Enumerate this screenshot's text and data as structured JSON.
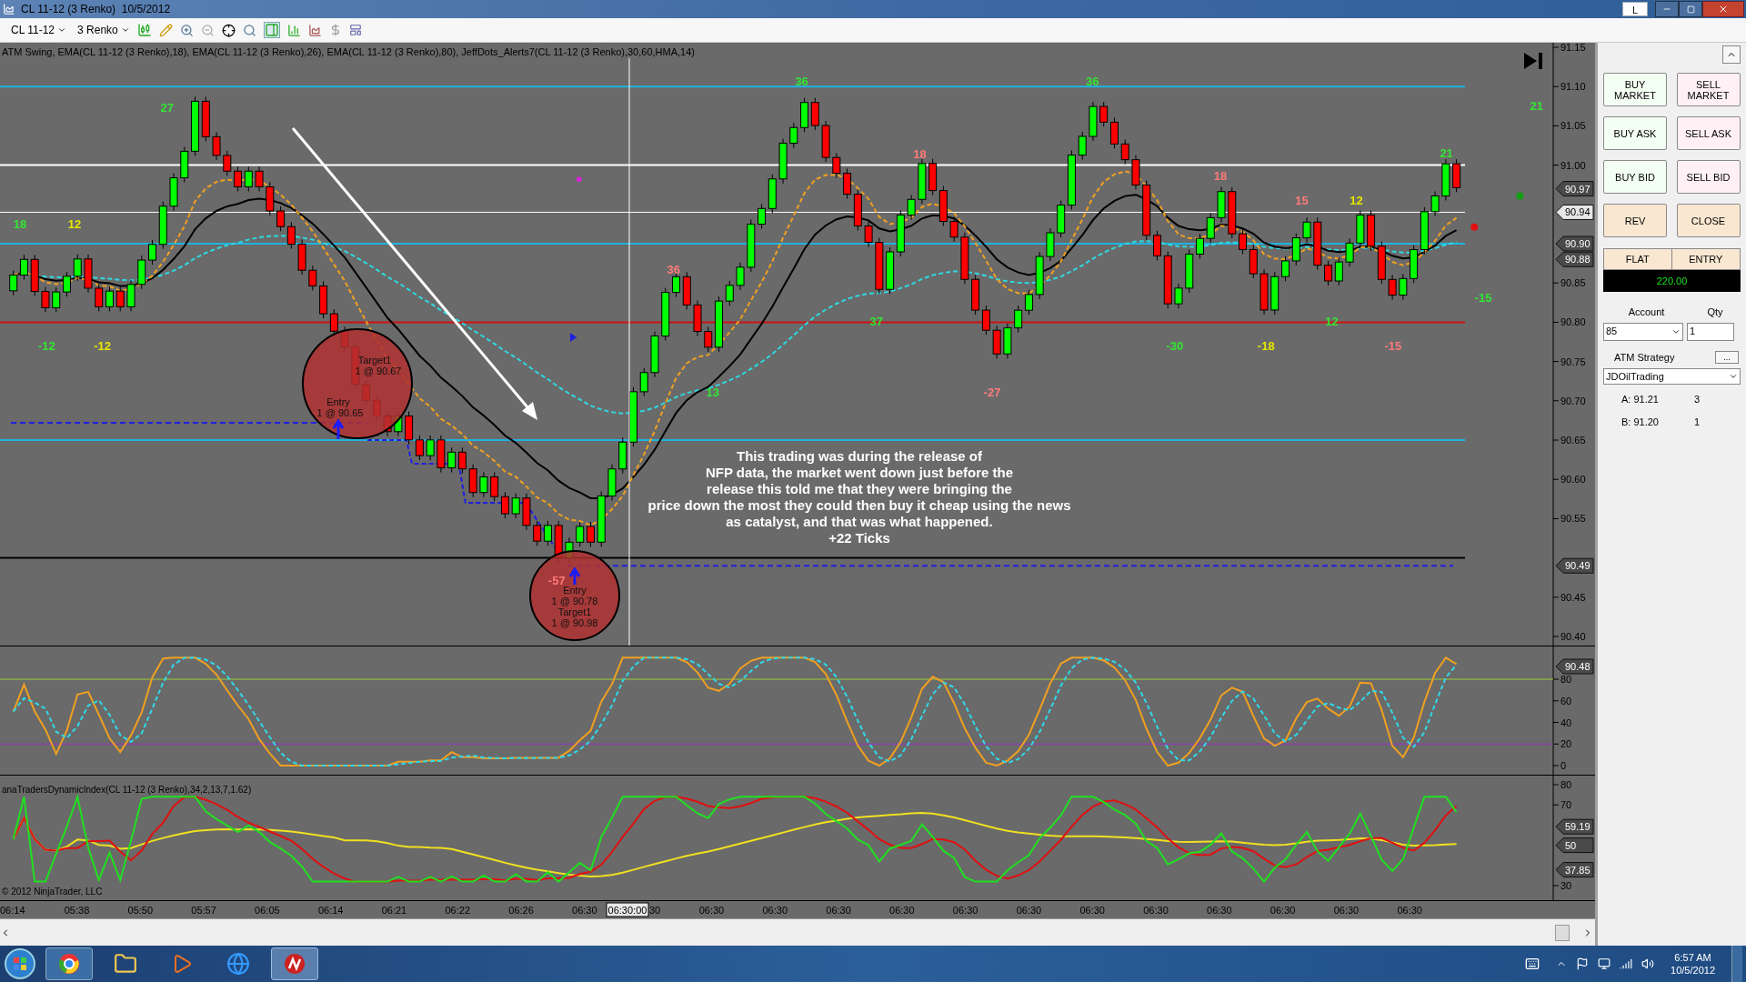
{
  "window": {
    "title": "CL 11-12 (3 Renko)  10/5/2012",
    "link_button": "L"
  },
  "toolbar": {
    "instrument": "CL 11-12",
    "period": "3 Renko"
  },
  "chart": {
    "indicators_label": "ATM Swing, EMA(CL 11-12 (3 Renko),18), EMA(CL 11-12 (3 Renko),26), EMA(CL 11-12 (3 Renko),80), JeffDots_Alerts7(CL 11-12 (3 Renko),30,60,HMA,14)",
    "price_ticks": [
      "91.15",
      "91.10",
      "91.05",
      "91.00",
      "90.85",
      "90.80",
      "90.75",
      "90.70",
      "90.65",
      "90.60",
      "90.55",
      "90.45",
      "90.40"
    ],
    "price_flags": [
      {
        "text": "90.97",
        "kind": "indicator"
      },
      {
        "text": "90.94",
        "kind": "last"
      },
      {
        "text": "90.90",
        "kind": "indicator"
      },
      {
        "text": "90.88",
        "kind": "indicator"
      },
      {
        "text": "90.49",
        "kind": "indicator"
      }
    ],
    "swing_labels": [
      {
        "text": "27",
        "color": "#33e633"
      },
      {
        "text": "18",
        "color": "#33e633"
      },
      {
        "text": "12",
        "color": "#e6e600"
      },
      {
        "text": "-12",
        "color": "#33e633"
      },
      {
        "text": "-12",
        "color": "#e6e600"
      },
      {
        "text": "36",
        "color": "#ff7a7a"
      },
      {
        "text": "13",
        "color": "#33e633"
      },
      {
        "text": "36",
        "color": "#33e633"
      },
      {
        "text": "18",
        "color": "#ff7a7a"
      },
      {
        "text": "37",
        "color": "#33e633"
      },
      {
        "text": "-27",
        "color": "#ff7a7a"
      },
      {
        "text": "36",
        "color": "#33e633"
      },
      {
        "text": "18",
        "color": "#ff7a7a"
      },
      {
        "text": "15",
        "color": "#ff7a7a"
      },
      {
        "text": "12",
        "color": "#e6e600"
      },
      {
        "text": "21",
        "color": "#33e633"
      },
      {
        "text": "21",
        "color": "#33e633"
      },
      {
        "text": "-15",
        "color": "#33e633"
      },
      {
        "text": "-30",
        "color": "#33e633"
      },
      {
        "text": "-18",
        "color": "#e6e600"
      },
      {
        "text": "12",
        "color": "#33e633"
      },
      {
        "text": "-15",
        "color": "#ff7a7a"
      },
      {
        "text": "-57",
        "color": "#ff7a7a"
      }
    ],
    "trades": [
      {
        "lines": [
          "Target1",
          "1 @ 90.67",
          "Entry",
          "1 @ 90.65"
        ]
      },
      {
        "lines": [
          "Entry",
          "1 @ 90.78",
          "Target1",
          "1 @ 90.98"
        ]
      }
    ],
    "note": [
      "This trading was during the release of",
      "NFP data, the market went down just before the",
      "release this told me that they were bringing the",
      "price down the most they could then buy it cheap using the news",
      "as catalyst, and that was what happened.",
      "+22 Ticks"
    ]
  },
  "oscillator": {
    "ticks": [
      "80",
      "60",
      "40",
      "20",
      "0"
    ],
    "flag": "90.48"
  },
  "dynamic_index": {
    "label": "anaTradersDynamicIndex(CL 11-12 (3 Renko),34,2,13,7,1.62)",
    "ticks": [
      "80",
      "70",
      "30"
    ],
    "flags": [
      "59.19",
      "50",
      "37.85"
    ],
    "copyright": "© 2012 NinjaTrader, LLC"
  },
  "time_axis": {
    "labels": [
      "06:14",
      "05:38",
      "05:50",
      "05:57",
      "06:05",
      "06:14",
      "06:21",
      "06:22",
      "06:26",
      "06:30",
      "06:30",
      "06:30",
      "06:30",
      "06:30",
      "06:30",
      "06:30",
      "06:30",
      "06:30",
      "06:30",
      "06:30",
      "06:30",
      "06:30"
    ],
    "cursor": "06:30:00",
    "cursor_tail": "30"
  },
  "order_panel": {
    "buttons": [
      {
        "label": "BUY MARKET",
        "kind": "buy"
      },
      {
        "label": "SELL MARKET",
        "kind": "sell"
      },
      {
        "label": "BUY ASK",
        "kind": "buy"
      },
      {
        "label": "SELL ASK",
        "kind": "sell"
      },
      {
        "label": "BUY BID",
        "kind": "buy"
      },
      {
        "label": "SELL BID",
        "kind": "sell"
      },
      {
        "label": "REV",
        "kind": "neutral"
      },
      {
        "label": "CLOSE",
        "kind": "neutral"
      }
    ],
    "position": {
      "state": "FLAT",
      "entry": "ENTRY",
      "pnl": "220.00"
    },
    "account": {
      "label": "Account",
      "value": "85"
    },
    "qty": {
      "label": "Qty",
      "value": "1"
    },
    "atm": {
      "label": "ATM Strategy",
      "value": "JDOilTrading",
      "more": "..."
    },
    "quotes": [
      {
        "label": "A: 91.21",
        "size": "3"
      },
      {
        "label": "B: 91.20",
        "size": "1"
      }
    ]
  },
  "taskbar": {
    "time": "6:57 AM",
    "date": "10/5/2012"
  }
}
